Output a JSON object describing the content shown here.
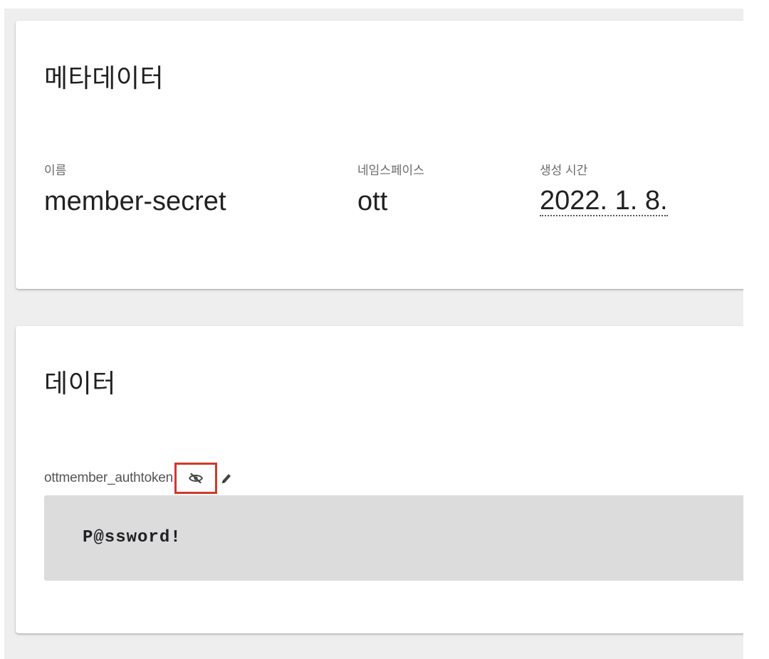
{
  "metadata_card": {
    "title": "메타데이터",
    "fields": [
      {
        "label": "이름",
        "value": "member-secret"
      },
      {
        "label": "네임스페이스",
        "value": "ott"
      },
      {
        "label": "생성 시간",
        "value": "2022. 1. 8."
      }
    ]
  },
  "data_card": {
    "title": "데이터",
    "entries": [
      {
        "key": "ottmember_authtoken",
        "value": "P@ssword!",
        "toggle_icon": "eye-off-icon",
        "edit_icon": "pencil-icon"
      }
    ]
  },
  "colors": {
    "highlight_box": "#d0392b",
    "secret_background": "#dcdcdc",
    "page_background": "#eeeeee"
  }
}
